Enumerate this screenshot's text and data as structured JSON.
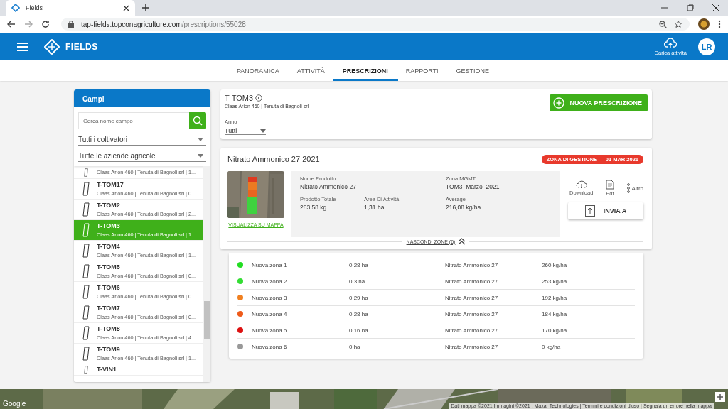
{
  "browser": {
    "tab_title": "Fields",
    "url_host": "tap-fields.topconagriculture.com",
    "url_path": "/prescriptions/55028"
  },
  "header": {
    "app_name": "FIELDS",
    "upload_label": "Carica attività",
    "avatar": "LR"
  },
  "nav": [
    {
      "label": "PANORAMICA",
      "selected": false
    },
    {
      "label": "ATTIVITÀ",
      "selected": false
    },
    {
      "label": "PRESCRIZIONI",
      "selected": true
    },
    {
      "label": "RAPPORTI",
      "selected": false
    },
    {
      "label": "GESTIONE",
      "selected": false
    }
  ],
  "sidebar": {
    "title": "Campi",
    "search_placeholder": "Cerca nome campo",
    "filters": [
      "Tutti i coltivatori",
      "Tutte le aziende agricole"
    ],
    "items": [
      {
        "subtitle": "Claas Arion 460 | Tenuta di Bagnoli srl | 1...",
        "selected": false
      },
      {
        "name": "T-TOM17",
        "subtitle": "Claas Arion 460 | Tenuta di Bagnoli srl | 0...",
        "selected": false
      },
      {
        "name": "T-TOM2",
        "subtitle": "Claas Arion 460 | Tenuta di Bagnoli srl | 2...",
        "selected": false
      },
      {
        "name": "T-TOM3",
        "subtitle": "Claas Arion 460 | Tenuta di Bagnoli srl | 1...",
        "selected": true
      },
      {
        "name": "T-TOM4",
        "subtitle": "Claas Arion 460 | Tenuta di Bagnoli srl | 1...",
        "selected": false
      },
      {
        "name": "T-TOM5",
        "subtitle": "Claas Arion 460 | Tenuta di Bagnoli srl | 0...",
        "selected": false
      },
      {
        "name": "T-TOM6",
        "subtitle": "Claas Arion 460 | Tenuta di Bagnoli srl | 0...",
        "selected": false
      },
      {
        "name": "T-TOM7",
        "subtitle": "Claas Arion 460 | Tenuta di Bagnoli srl | 0...",
        "selected": false
      },
      {
        "name": "T-TOM8",
        "subtitle": "Claas Arion 460 | Tenuta di Bagnoli srl | 4...",
        "selected": false
      },
      {
        "name": "T-TOM9",
        "subtitle": "Claas Arion 460 | Tenuta di Bagnoli srl | 1...",
        "selected": false
      },
      {
        "name": "T-VIN1",
        "selected": false
      }
    ]
  },
  "field": {
    "name": "T-TOM3",
    "subtitle": "Claas Arion 460 | Tenuta di Bagnoli srl",
    "new_button": "NUOVA PRESCRIZIONE",
    "year_label": "Anno",
    "year_value": "Tutti"
  },
  "prescription": {
    "title": "Nitrato Ammonico 27 2021",
    "badge": "ZONA DI GESTIONE — 01 MAR 2021",
    "map_link": "VISUALIZZA SU MAPPA",
    "stats_left": [
      {
        "label": "Nome Prodotto",
        "value": "Nitrato Ammonico 27"
      },
      {
        "label": "Prodotto Totale",
        "value": "283,58 kg"
      },
      {
        "label": "Area Di Attività",
        "value": "1,31 ha"
      }
    ],
    "stats_right": [
      {
        "label": "Zona MGMT",
        "value": "TOM3_Marzo_2021"
      },
      {
        "label": "Average",
        "value": "216,08 kg/ha"
      }
    ],
    "actions": {
      "download": "Download",
      "pdf": "Pdf",
      "more": "Altro",
      "send": "INVIA A"
    },
    "toggle": "NASCONDI ZONE (6)"
  },
  "zones": [
    {
      "name": "Nuova zona 1",
      "area": "0,28 ha",
      "product": "Nitrato Ammonico 27",
      "rate": "260 kg/ha",
      "color": "#22dd22"
    },
    {
      "name": "Nuova zona 2",
      "area": "0,3 ha",
      "product": "Nitrato Ammonico 27",
      "rate": "253 kg/ha",
      "color": "#33dd33"
    },
    {
      "name": "Nuova zona 3",
      "area": "0,29 ha",
      "product": "Nitrato Ammonico 27",
      "rate": "192 kg/ha",
      "color": "#f08020"
    },
    {
      "name": "Nuova zona 4",
      "area": "0,28 ha",
      "product": "Nitrato Ammonico 27",
      "rate": "184 kg/ha",
      "color": "#ee5a1a"
    },
    {
      "name": "Nuova zona 5",
      "area": "0,16 ha",
      "product": "Nitrato Ammonico 27",
      "rate": "170 kg/ha",
      "color": "#dd1111"
    },
    {
      "name": "Nuova zona 6",
      "area": "0 ha",
      "product": "Nitrato Ammonico 27",
      "rate": "0 kg/ha",
      "color": "#999999"
    }
  ],
  "map_footer": {
    "logo": "Google",
    "attribution": "Dati mappa ©2021 Immagini ©2021 , Maxar Technologies | Termini e condizioni d'uso | Segnala un errore nella mappa"
  }
}
